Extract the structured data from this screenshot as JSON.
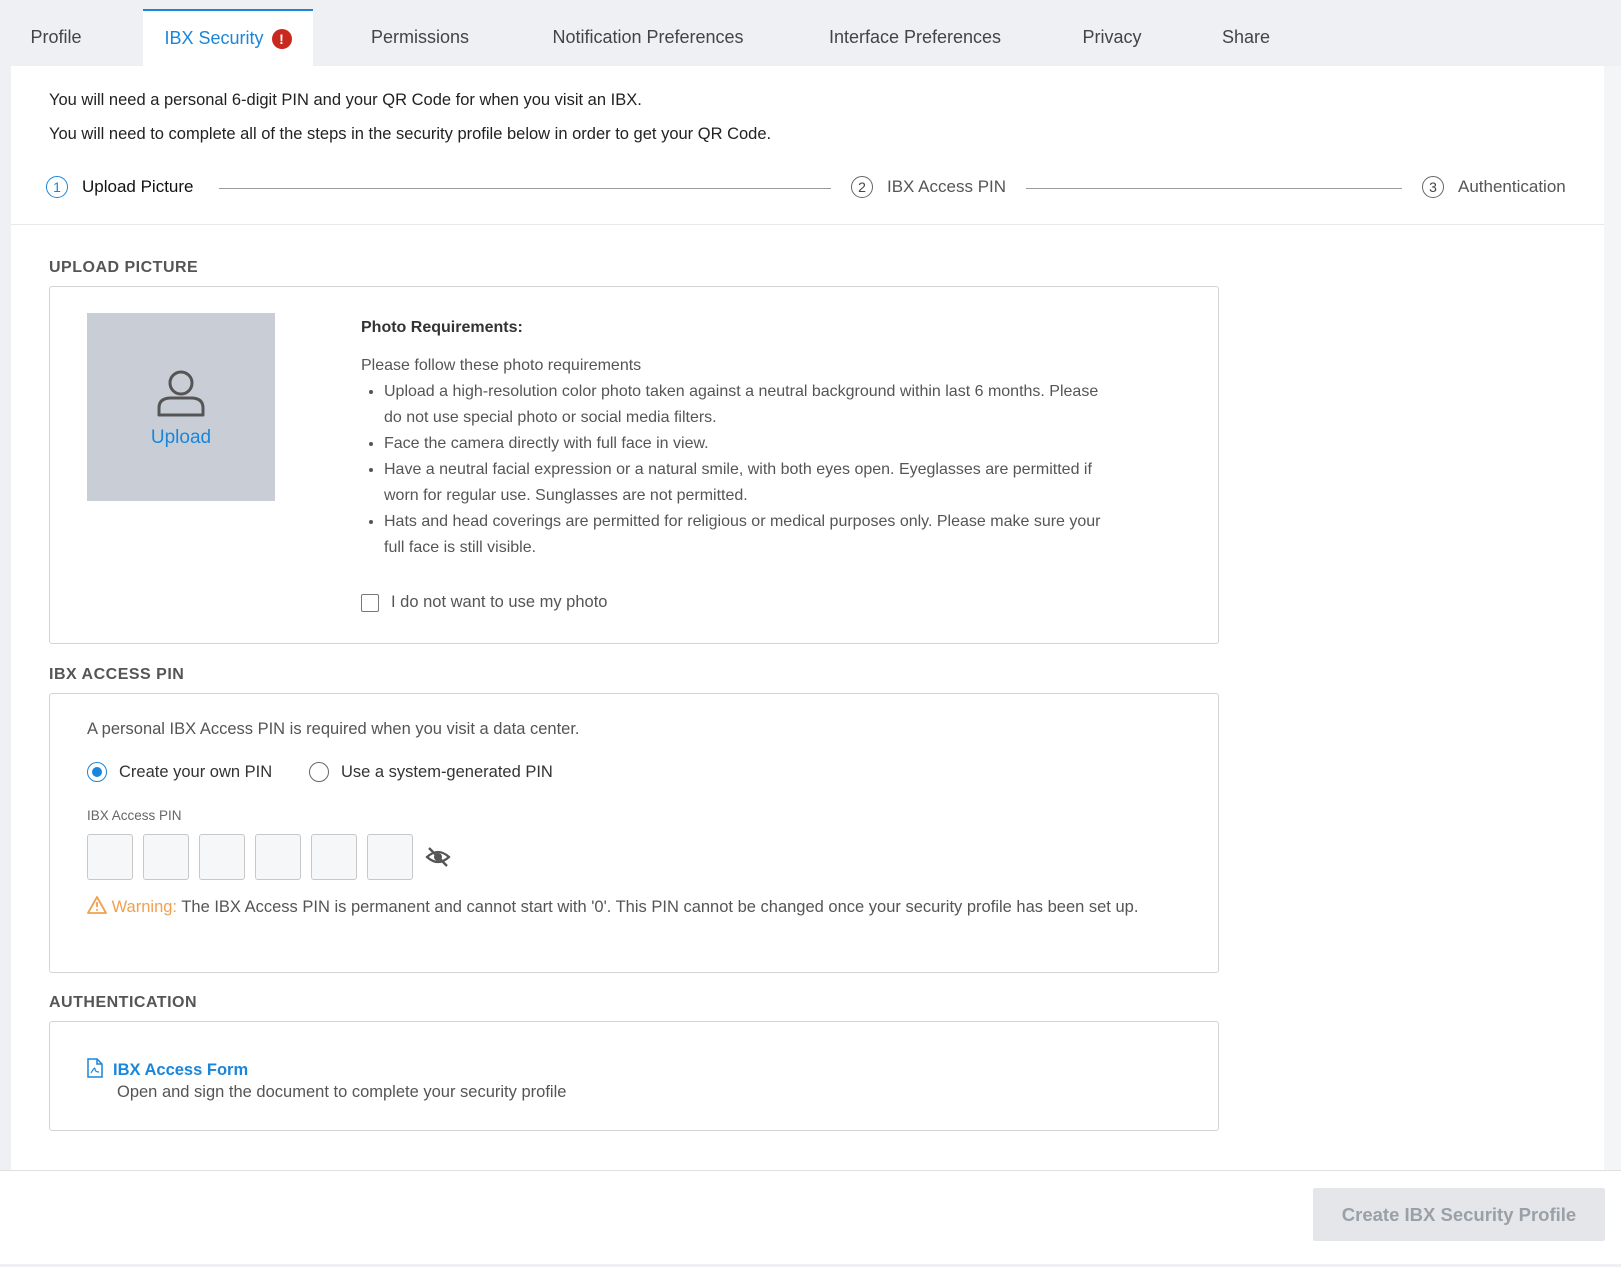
{
  "tabs": [
    {
      "label": "Profile"
    },
    {
      "label": "IBX Security",
      "alert": "!"
    },
    {
      "label": "Permissions"
    },
    {
      "label": "Notification Preferences"
    },
    {
      "label": "Interface Preferences"
    },
    {
      "label": "Privacy"
    },
    {
      "label": "Share"
    }
  ],
  "active_tab": "IBX Security",
  "intro": {
    "line1": "You will need a personal 6-digit PIN and your QR Code for when you visit an IBX.",
    "line2": "You will need to complete all of the steps in the security profile below in order to get your QR Code."
  },
  "steps": [
    {
      "num": "1",
      "label": "Upload Picture",
      "active": true
    },
    {
      "num": "2",
      "label": "IBX Access PIN",
      "active": false
    },
    {
      "num": "3",
      "label": "Authentication",
      "active": false
    }
  ],
  "upload_section": {
    "title": "UPLOAD PICTURE",
    "upload_label": "Upload",
    "req_title": "Photo Requirements:",
    "req_intro": "Please follow these photo requirements",
    "requirements": [
      "Upload a high-resolution color photo taken against a neutral background within last 6 months. Please do not use special photo or social media filters.",
      "Face the camera directly with full face in view.",
      "Have a neutral facial expression or a natural smile, with both eyes open. Eyeglasses are permitted if worn for regular use. Sunglasses are not permitted.",
      "Hats and head coverings are permitted for religious or medical purposes only. Please make sure your full face is still visible."
    ],
    "no_photo_label": "I do not want to use my photo",
    "no_photo_checked": false
  },
  "pin_section": {
    "title": "IBX ACCESS PIN",
    "description": "A personal IBX Access PIN is required when you visit a data center.",
    "option_own": "Create your own PIN",
    "option_system": "Use a system-generated PIN",
    "selected": "own",
    "field_label": "IBX Access PIN",
    "digits": [
      "",
      "",
      "",
      "",
      "",
      ""
    ],
    "warning_word": "Warning:",
    "warning_text": "The IBX Access PIN is permanent and cannot start with '0'. This PIN cannot be changed once your security profile has been set up."
  },
  "auth_section": {
    "title": "AUTHENTICATION",
    "link_label": "IBX Access Form",
    "description": "Open and sign the document to complete your security profile"
  },
  "footer": {
    "create_label": "Create IBX Security Profile",
    "create_enabled": false
  },
  "colors": {
    "accent": "#1a86db",
    "alert": "#c8281e",
    "warning": "#f0a050",
    "disabled_bg": "#e4e6ea"
  },
  "icons": {
    "upload": "user-icon",
    "visibility": "eye-off-icon",
    "warning": "warning-triangle-icon",
    "document": "pdf-document-icon"
  }
}
